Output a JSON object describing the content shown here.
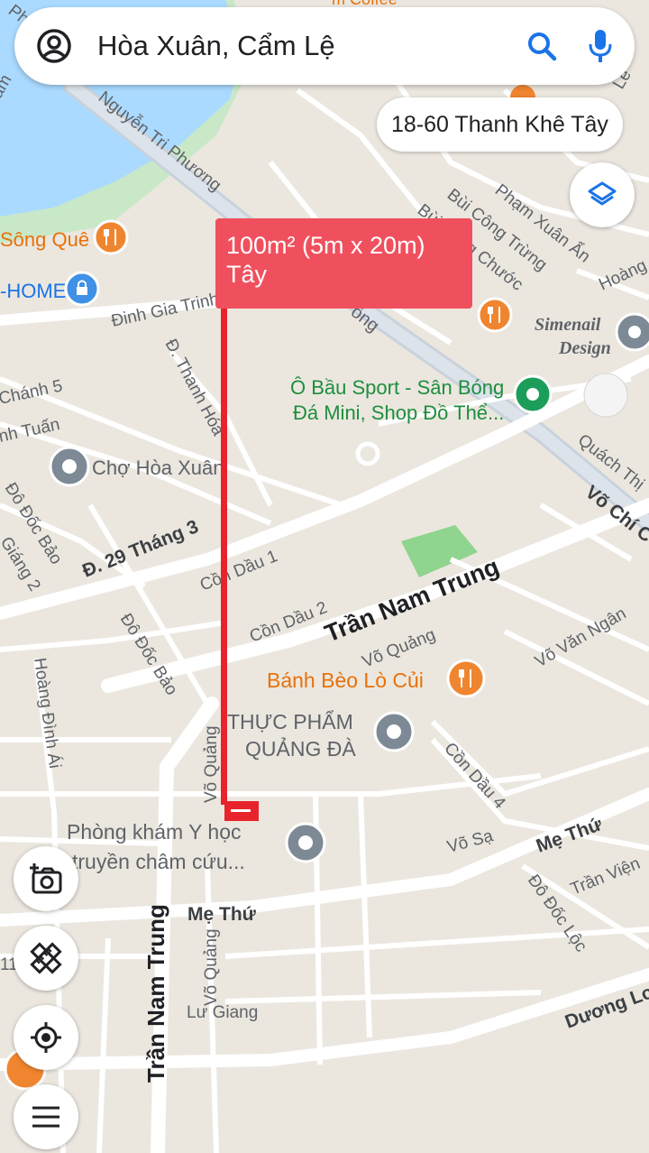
{
  "search": {
    "text": "Hòa Xuân, Cẩm Lệ"
  },
  "address_chip": "18-60 Thanh Khê Tây",
  "measurement": {
    "line1": "100m² (5m x 20m)",
    "line2": "Tây"
  },
  "places": {
    "song_que": "Sông Quê",
    "home": "-HOME",
    "simenail_1": "Simenail",
    "simenail_2": "Design",
    "bau_sport_1": "Ô Bầu Sport - Sân Bóng",
    "bau_sport_2": "Đá Mini, Shop Đồ Thể...",
    "cho_hoa_xuan": "Chợ Hòa Xuân",
    "banh_beo": "Bánh Bèo Lò Củi",
    "thuc_pham_1": "THỰC PHẨM",
    "thuc_pham_2": "QUẢNG ĐÀ",
    "phong_kham_1": "Phòng khám Y học",
    "phong_kham_2": "truyền châm cứu...",
    "top_partial": "m Coffee"
  },
  "streets": {
    "nguyen_tri_phuong": "Nguyễn Tri Phương",
    "dinh_gia_trinh": "Đinh Gia Trinh",
    "bui_cong_trung": "Bùi Công Trừng",
    "bui_chuoc": "Bùi Công Chước",
    "pham_xuan_an": "Phạm Xuân Ẩn",
    "hoang": "Hoàng",
    "ong": "ông",
    "thanh_hoa": "Đ. Thanh Hóa",
    "chanh5": "Chánh 5",
    "tuan": "nh Tuấn",
    "quach_thi": "Quách Thị",
    "vo_chi": "Võ Chí C",
    "do_doc_bao_1": "Đô Đốc Bảo",
    "do_doc_bao_2": "Đô Đốc Bảo",
    "giang2": "Giáng 2",
    "thang3": "Đ. 29 Tháng 3",
    "con_dau_1": "Cồn Dầu 1",
    "con_dau_2": "Cồn Dầu 2",
    "tran_nam_trung_1": "Trần Nam Trung",
    "tran_nam_trung_2": "Trần Nam Trung",
    "vo_quang_1": "Võ Quảng",
    "vo_quang_2": "Võ Quảng",
    "vo_quang_3": "Võ Quảng",
    "vo_van_ngan": "Võ Văn Ngân",
    "hoang_dinh_ai": "Hoàng Đình Ái",
    "con_dau_4": "Cồn Dầu 4",
    "vo_sa": "Võ Sạ",
    "me_thu_1": "Mẹ Thứ",
    "me_thu_2": "Mẹ Thứ",
    "tran_vien": "Trần Viện",
    "do_doc_loc": "Đô Đốc Lộc",
    "duong_lo": "Dương Lo",
    "lu_giang": "Lư Giang",
    "top_ph": "Ph",
    "top_left_am": "am",
    "top_right_l": "Lê",
    "left_11": "11"
  },
  "colors": {
    "water": "#aadaff",
    "park": "#c9e8c8",
    "green_field": "#8fd48f",
    "measure": "#f0505e",
    "food_pin": "#f0852f",
    "gray_pin": "#7d8a96",
    "blue_pin": "#3f90e6",
    "green_pin": "#1c9e5a",
    "road": "#ffffff",
    "major_road": "#c9d2dc"
  },
  "icons": [
    "account-icon",
    "search-icon",
    "microphone-icon",
    "layers-icon",
    "camera-plus-icon",
    "ruler-cross-icon",
    "my-location-icon",
    "menu-icon",
    "food-pin-icon",
    "shop-pin-icon",
    "gray-place-pin-icon",
    "green-place-pin-icon"
  ]
}
